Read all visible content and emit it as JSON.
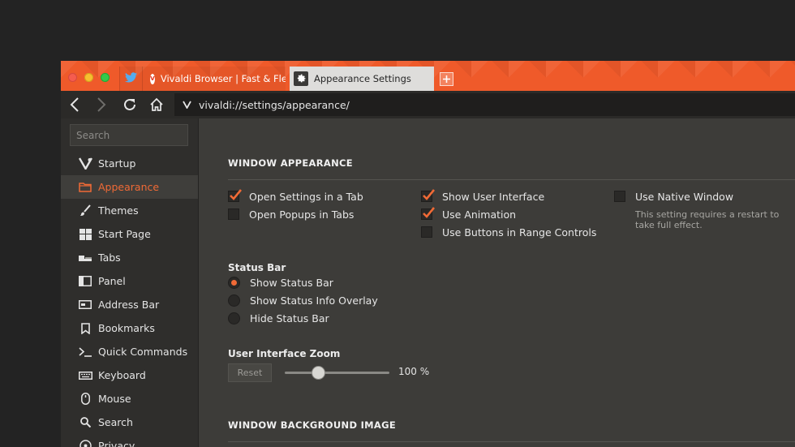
{
  "tabs": {
    "twitter": {
      "icon": "twitter-icon"
    },
    "vivaldi": {
      "title": "Vivaldi Browser | Fast & Flexib",
      "icon": "vivaldi-icon"
    },
    "active": {
      "title": "Appearance Settings",
      "icon": "gear-icon"
    }
  },
  "address": {
    "url": "vivaldi://settings/appearance/"
  },
  "sidebar": {
    "search_placeholder": "Search",
    "items": [
      {
        "label": "Startup",
        "icon": "vivaldi-logo-icon"
      },
      {
        "label": "Appearance",
        "icon": "folder-icon",
        "active": true
      },
      {
        "label": "Themes",
        "icon": "brush-icon"
      },
      {
        "label": "Start Page",
        "icon": "grid-icon"
      },
      {
        "label": "Tabs",
        "icon": "tabs-icon"
      },
      {
        "label": "Panel",
        "icon": "panel-icon"
      },
      {
        "label": "Address Bar",
        "icon": "address-bar-icon"
      },
      {
        "label": "Bookmarks",
        "icon": "bookmark-icon"
      },
      {
        "label": "Quick Commands",
        "icon": "terminal-icon"
      },
      {
        "label": "Keyboard",
        "icon": "keyboard-icon"
      },
      {
        "label": "Mouse",
        "icon": "mouse-icon"
      },
      {
        "label": "Search",
        "icon": "search-icon"
      },
      {
        "label": "Privacy",
        "icon": "privacy-icon"
      }
    ]
  },
  "main": {
    "window_appearance_title": "WINDOW APPEARANCE",
    "checkboxes": {
      "open_settings_in_tab": {
        "label": "Open Settings in a Tab",
        "checked": true
      },
      "open_popups_in_tabs": {
        "label": "Open Popups in Tabs",
        "checked": false
      },
      "show_user_interface": {
        "label": "Show User Interface",
        "checked": true
      },
      "use_animation": {
        "label": "Use Animation",
        "checked": true
      },
      "use_buttons_range": {
        "label": "Use Buttons in Range Controls",
        "checked": false
      },
      "use_native_window": {
        "label": "Use Native Window",
        "checked": false
      }
    },
    "native_window_hint": "This setting requires a restart to take full effect.",
    "status_bar": {
      "title": "Status Bar",
      "options": [
        "Show Status Bar",
        "Show Status Info Overlay",
        "Hide Status Bar"
      ],
      "selected": "Show Status Bar"
    },
    "zoom": {
      "title": "User Interface Zoom",
      "reset_label": "Reset",
      "value_label": "100 %",
      "slider_fraction": 0.32
    },
    "window_background_title": "WINDOW BACKGROUND IMAGE"
  },
  "colors": {
    "accent": "#f06a36",
    "tabbar": "#ef5a2a"
  }
}
